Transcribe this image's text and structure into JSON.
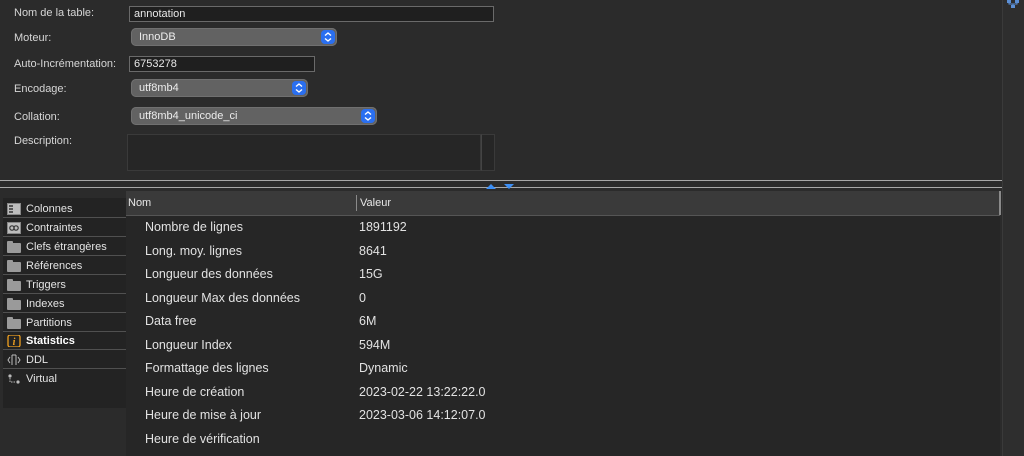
{
  "form": {
    "table_name_label": "Nom de la table:",
    "table_name_value": "annotation",
    "engine_label": "Moteur:",
    "engine_value": "InnoDB",
    "auto_increment_label": "Auto-Incrémentation:",
    "auto_increment_value": "6753278",
    "encoding_label": "Encodage:",
    "encoding_value": "utf8mb4",
    "collation_label": "Collation:",
    "collation_value": "utf8mb4_unicode_ci",
    "description_label": "Description:",
    "description_value": ""
  },
  "sidebar": {
    "items": [
      {
        "label": "Colonnes",
        "icon": "columns-icon"
      },
      {
        "label": "Contraintes",
        "icon": "constraints-icon"
      },
      {
        "label": "Clefs étrangères",
        "icon": "folder-icon"
      },
      {
        "label": "Références",
        "icon": "folder-icon"
      },
      {
        "label": "Triggers",
        "icon": "folder-icon"
      },
      {
        "label": "Indexes",
        "icon": "folder-icon"
      },
      {
        "label": "Partitions",
        "icon": "folder-icon"
      },
      {
        "label": "Statistics",
        "icon": "info-icon",
        "active": true
      },
      {
        "label": "DDL",
        "icon": "ddl-icon"
      },
      {
        "label": "Virtual",
        "icon": "virtual-icon"
      }
    ]
  },
  "table": {
    "headers": [
      "Nom",
      "Valeur"
    ],
    "rows": [
      [
        "Nombre de lignes",
        "1891192"
      ],
      [
        "Long. moy. lignes",
        "8641"
      ],
      [
        "Longueur des données",
        "15G"
      ],
      [
        "Longueur Max des données",
        "0"
      ],
      [
        "Data free",
        "6M"
      ],
      [
        "Longueur Index",
        "594M"
      ],
      [
        "Formattage des lignes",
        "Dynamic"
      ],
      [
        "Heure de création",
        "2023-02-22 13:22:22.0"
      ],
      [
        "Heure de mise à jour",
        "2023-03-06 14:12:07.0"
      ],
      [
        "Heure de vérification",
        ""
      ]
    ]
  },
  "colors": {
    "accent": "#2a6ff0",
    "splitter_arrow": "#3d8ff5",
    "info_icon": "#f0a020"
  }
}
